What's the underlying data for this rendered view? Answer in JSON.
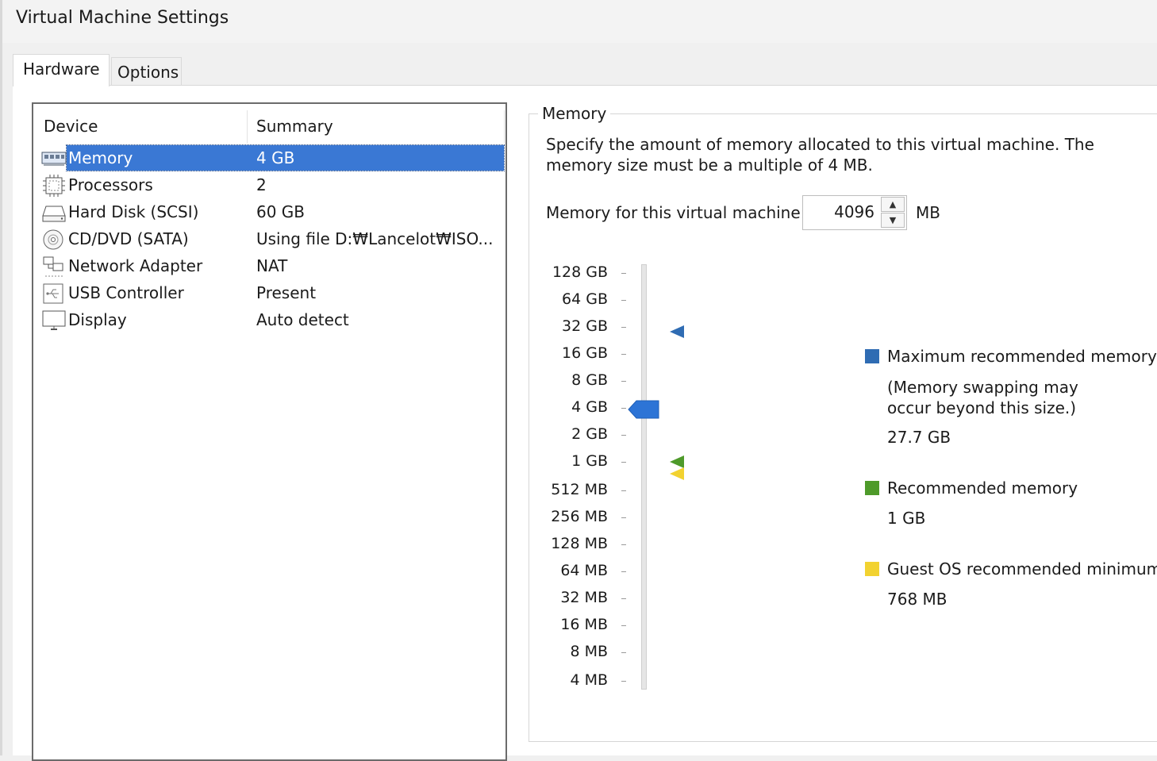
{
  "window": {
    "title": "Virtual Machine Settings"
  },
  "tabs": [
    {
      "label": "Hardware",
      "active": true
    },
    {
      "label": "Options",
      "active": false
    }
  ],
  "device_list": {
    "columns": [
      "Device",
      "Summary"
    ],
    "rows": [
      {
        "device": "Memory",
        "summary": "4 GB",
        "icon": "memory-icon",
        "selected": true
      },
      {
        "device": "Processors",
        "summary": "2",
        "icon": "processor-icon"
      },
      {
        "device": "Hard Disk (SCSI)",
        "summary": "60 GB",
        "icon": "hard-disk-icon"
      },
      {
        "device": "CD/DVD (SATA)",
        "summary": "Using file D:₩Lancelot₩ISO...",
        "icon": "cd-dvd-icon"
      },
      {
        "device": "Network Adapter",
        "summary": "NAT",
        "icon": "network-adapter-icon"
      },
      {
        "device": "USB Controller",
        "summary": "Present",
        "icon": "usb-controller-icon"
      },
      {
        "device": "Display",
        "summary": "Auto detect",
        "icon": "display-icon"
      }
    ]
  },
  "memory_panel": {
    "group_title": "Memory",
    "description": "Specify the amount of memory allocated to this virtual machine. The memory size must be a multiple of 4 MB.",
    "field_label": "Memory for this virtual machine:",
    "field_value": "4096",
    "unit": "MB",
    "slider": {
      "ticks": [
        "128 GB",
        "64 GB",
        "32 GB",
        "16 GB",
        "8 GB",
        "4 GB",
        "2 GB",
        "1 GB",
        "512 MB",
        "256 MB",
        "128 MB",
        "64 MB",
        "32 MB",
        "16 MB",
        "8 MB",
        "4 MB"
      ],
      "current": "4 GB",
      "max_recommended_marker": "32 GB",
      "recommended_marker": "1 GB",
      "guest_min_marker": "768 MB"
    },
    "legend": {
      "max": {
        "title": "Maximum recommended memory",
        "note": "(Memory swapping may occur beyond this size.)",
        "value": "27.7 GB",
        "color": "#2f6cb3"
      },
      "recommended": {
        "title": "Recommended memory",
        "value": "1 GB",
        "color": "#4e9a2a"
      },
      "guest_min": {
        "title": "Guest OS recommended minimum",
        "value": "768 MB",
        "color": "#f2d230"
      }
    },
    "colors": {
      "selection": "#3a78d4",
      "thumb": "#2d74d6"
    }
  }
}
